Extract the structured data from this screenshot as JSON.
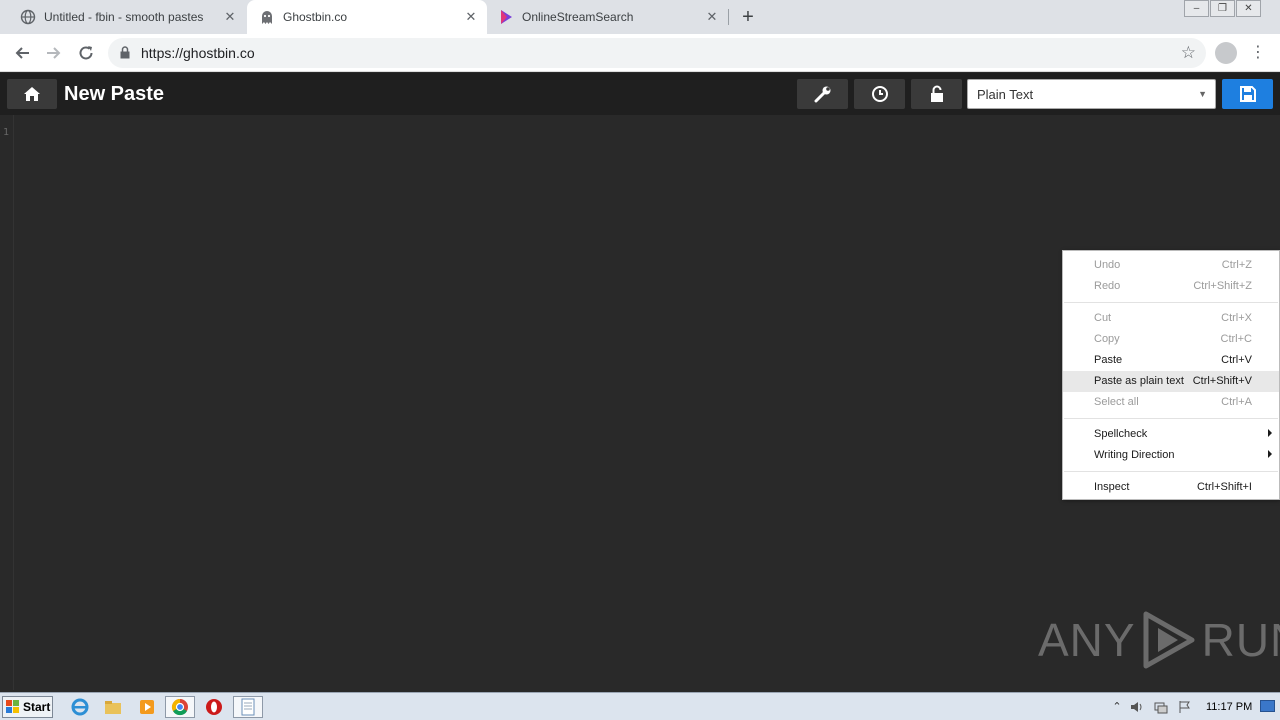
{
  "browser": {
    "tabs": [
      {
        "title": "Untitled - fbin - smooth pastes",
        "active": false
      },
      {
        "title": "Ghostbin.co",
        "active": true
      },
      {
        "title": "OnlineStreamSearch",
        "active": false
      }
    ],
    "address": "https://ghostbin.co"
  },
  "page": {
    "title": "New Paste",
    "language": "Plain Text",
    "line_number": "1"
  },
  "context_menu": {
    "items": [
      {
        "label": "Undo",
        "shortcut": "Ctrl+Z"
      },
      {
        "label": "Redo",
        "shortcut": "Ctrl+Shift+Z"
      },
      {
        "label": "Cut",
        "shortcut": "Ctrl+X"
      },
      {
        "label": "Copy",
        "shortcut": "Ctrl+C"
      },
      {
        "label": "Paste",
        "shortcut": "Ctrl+V"
      },
      {
        "label": "Paste as plain text",
        "shortcut": "Ctrl+Shift+V"
      },
      {
        "label": "Select all",
        "shortcut": "Ctrl+A"
      },
      {
        "label": "Spellcheck",
        "shortcut": ""
      },
      {
        "label": "Writing Direction",
        "shortcut": ""
      },
      {
        "label": "Inspect",
        "shortcut": "Ctrl+Shift+I"
      }
    ]
  },
  "watermark": {
    "left": "ANY",
    "right": "RUN"
  },
  "taskbar": {
    "start_label": "Start",
    "clock": "11:17 PM"
  },
  "colors": {
    "page_bg": "#292929",
    "header_bg": "#1f1f1f",
    "save_accent": "#1e7fe0"
  }
}
